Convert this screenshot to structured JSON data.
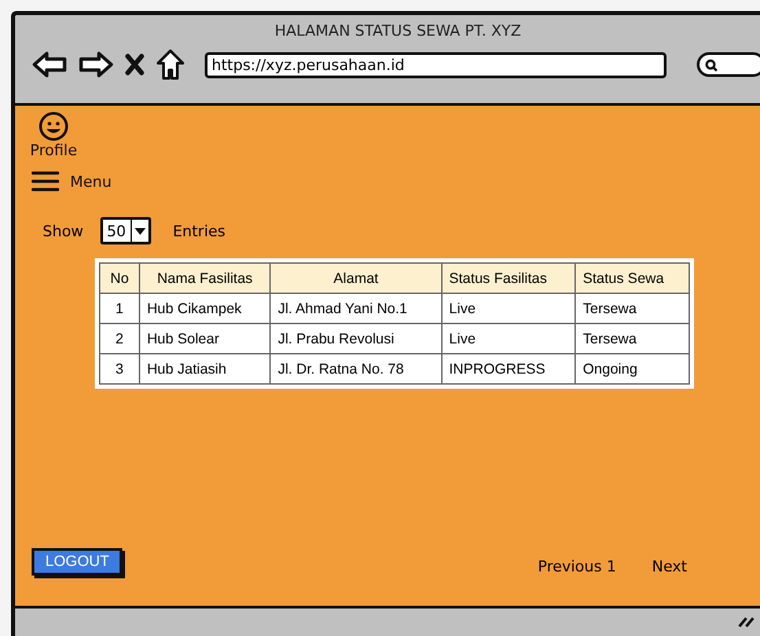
{
  "window": {
    "title": "HALAMAN STATUS SEWA PT. XYZ",
    "url": "https://xyz.perusahaan.id"
  },
  "profile": {
    "label": "Profile"
  },
  "menu": {
    "label": "Menu"
  },
  "entries": {
    "show_label": "Show",
    "value": "50",
    "entries_label": "Entries"
  },
  "table": {
    "columns": [
      "No",
      "Nama Fasilitas",
      "Alamat",
      "Status Fasilitas",
      "Status Sewa"
    ],
    "rows": [
      [
        "1",
        "Hub Cikampek",
        "Jl. Ahmad Yani No.1",
        "Live",
        "Tersewa"
      ],
      [
        "2",
        "Hub Solear",
        "Jl. Prabu Revolusi",
        "Live",
        "Tersewa"
      ],
      [
        "3",
        "Hub Jatiasih",
        "Jl. Dr. Ratna No. 78",
        "INPROGRESS",
        "Ongoing"
      ]
    ]
  },
  "logout_button": "LOGOUT",
  "pagination": {
    "previous": "Previous 1",
    "next": "Next"
  }
}
